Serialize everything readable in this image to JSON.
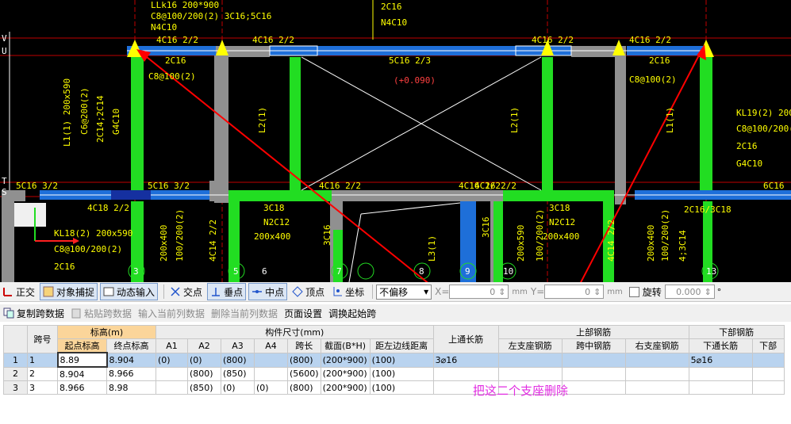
{
  "drawing": {
    "texts_yellow": [
      "LLk16 200*900",
      "C8@100/200(2) 3C16;5C16",
      "N4C10",
      "2C16",
      "N4C10",
      "4C16 2/2",
      "4C16 2/2",
      "4C16 2/2",
      "4C16 2/2",
      "2C16",
      "C8@100(2)",
      "5C16 2/3",
      "(+0.090)",
      "2C16",
      "C8@100(2)",
      "L1(1) 200x590",
      "C6@200(2)",
      "2C14;2C14",
      "G4C10",
      "L2(1)",
      "L2(1)",
      "L1(1)",
      "KL19(2) 200x5",
      "C8@100/200(2",
      "2C16",
      "G4C10",
      "5C16 3/2",
      "5C16 3/2",
      "4C16 2/2",
      "4C16 2/2",
      "4C16 2/2",
      "6C16",
      "4C18 2/2",
      "3C18",
      "N2C12",
      "200x400",
      "3C18",
      "N2C12",
      "200x400",
      "2C16/3C18",
      "KL18(2) 200x590",
      "C8@100/200(2)",
      "2C16",
      "200x400",
      "100/200(2)",
      "4C14 2/2",
      "3C16",
      "3C16",
      "L3(1)",
      "200x590",
      "100/200(2)",
      "4C14 2/2",
      "200x400",
      "100/200(2)",
      "4;3C14"
    ],
    "axis_labels": [
      "V",
      "U",
      "T",
      "S",
      "3",
      "5",
      "6",
      "7",
      "8",
      "9",
      "10",
      "13"
    ]
  },
  "snap_toolbar": {
    "items": [
      "正交",
      "对象捕捉",
      "动态输入",
      "交点",
      "垂点",
      "中点",
      "顶点",
      "坐标"
    ],
    "offset_mode": "不偏移",
    "x_label": "X=",
    "x_value": "0",
    "y_label": "Y=",
    "y_value": "0",
    "unit": "mm",
    "rotate_label": "旋转",
    "rotate_value": "0.000",
    "degree": "°"
  },
  "table_toolbar": {
    "items": [
      "复制跨数据",
      "粘贴跨数据",
      "输入当前列数据",
      "删除当前列数据",
      "页面设置",
      "调换起始跨"
    ]
  },
  "table": {
    "group_headers": [
      "标高(m)",
      "构件尺寸(mm)",
      "上通长筋",
      "上部钢筋",
      "下部钢筋"
    ],
    "span_header": "跨号",
    "sub_headers": [
      "起点标高",
      "终点标高",
      "A1",
      "A2",
      "A3",
      "A4",
      "跨长",
      "截面(B*H)",
      "距左边线距离",
      "左支座钢筋",
      "跨中钢筋",
      "右支座钢筋",
      "下通长筋",
      "下部"
    ],
    "rows": [
      {
        "idx": "1",
        "span": "1",
        "start": "8.89",
        "end": "8.904",
        "a1": "(0)",
        "a2": "(0)",
        "a3": "(800)",
        "a4": "",
        "len": "(800)",
        "sec": "(200*900)",
        "dist": "(100)",
        "top": "3⌀16",
        "bot": "5⌀16"
      },
      {
        "idx": "2",
        "span": "2",
        "start": "8.904",
        "end": "8.966",
        "a1": "",
        "a2": "(800)",
        "a3": "(850)",
        "a4": "",
        "len": "(5600)",
        "sec": "(200*900)",
        "dist": "(100)",
        "top": "",
        "bot": ""
      },
      {
        "idx": "3",
        "span": "3",
        "start": "8.966",
        "end": "8.98",
        "a1": "",
        "a2": "(850)",
        "a3": "(0)",
        "a4": "(0)",
        "len": "(800)",
        "sec": "(200*900)",
        "dist": "(100)",
        "top": "",
        "bot": ""
      }
    ]
  },
  "annotation": "把这二个支座删除",
  "colors": {
    "accent_arrow": "#ff0000",
    "annotation": "#e22de2",
    "beam_blue": "#1e6fd9",
    "column_green": "#22dd22"
  }
}
